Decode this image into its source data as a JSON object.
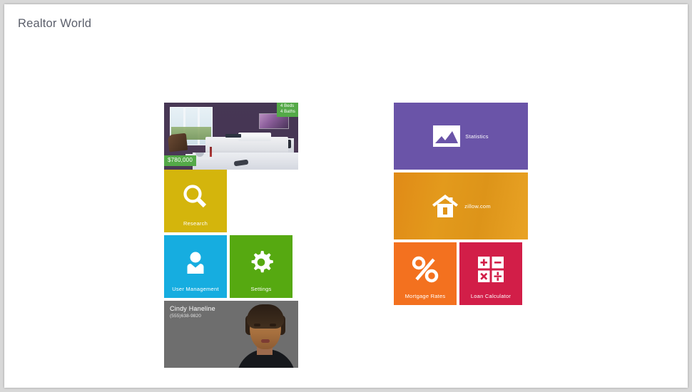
{
  "app": {
    "title": "Realtor World"
  },
  "tiles": {
    "property": {
      "name": "property-listing",
      "beds": "4 Beds",
      "baths": "4 Baths",
      "price": "$780,000",
      "badge_color": "#54a948",
      "photo_alt": "living-room-photo"
    },
    "research": {
      "label": "Research",
      "color": "#d4b50c",
      "icon": "search-icon"
    },
    "user_management": {
      "label": "User Management",
      "color": "#16ade0",
      "icon": "person-icon"
    },
    "settings": {
      "label": "Settings",
      "color": "#56a911",
      "icon": "gear-icon"
    },
    "contact": {
      "name": "Cindy Haneline",
      "phone": "(555)638-9820",
      "color": "#6e6e6e",
      "photo_alt": "agent-portrait"
    },
    "statistics": {
      "label": "Statistics",
      "color": "#6a54a8",
      "icon": "chart-icon"
    },
    "zillow": {
      "label": "zillow.com",
      "color": "#e09418",
      "icon": "house-icon"
    },
    "mortgage_rates": {
      "label": "Mortgage Rates",
      "color": "#f3711f",
      "icon": "percent-icon"
    },
    "loan_calculator": {
      "label": "Loan Calculator",
      "color": "#d21e48",
      "icon": "calculator-icon"
    }
  }
}
